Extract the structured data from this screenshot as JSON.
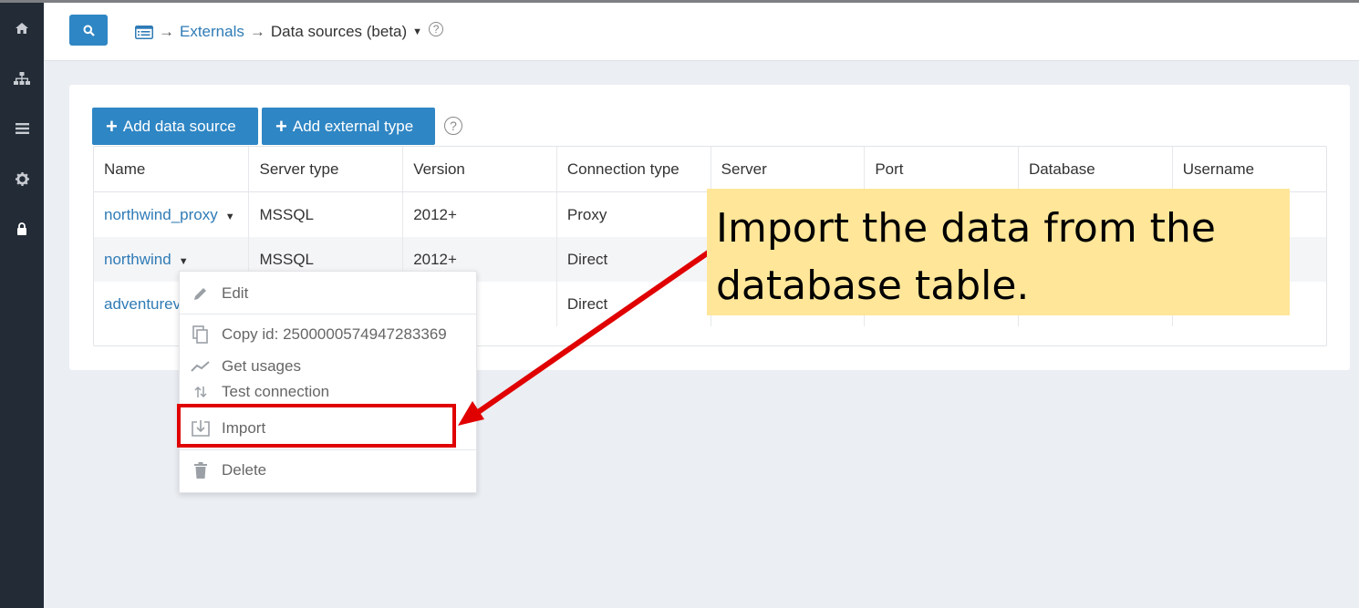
{
  "breadcrumb": {
    "items": [
      "Externals",
      "Data sources (beta)"
    ],
    "separator": "→"
  },
  "toolbar": {
    "add_data_source": "Add data source",
    "add_external_type": "Add external type"
  },
  "table": {
    "columns": [
      "Name",
      "Server type",
      "Version",
      "Connection type",
      "Server",
      "Port",
      "Database",
      "Username"
    ],
    "rows": [
      {
        "name": "northwind_proxy",
        "server_type": "MSSQL",
        "version": "2012+",
        "connection_type": "Proxy"
      },
      {
        "name": "northwind",
        "server_type": "MSSQL",
        "version": "2012+",
        "connection_type": "Direct"
      },
      {
        "name": "adventurev",
        "server_type": "",
        "version": "",
        "connection_type": "Direct"
      }
    ]
  },
  "context_menu": {
    "items": [
      "Edit",
      "Copy id: 2500000574947283369",
      "Get usages",
      "Test connection",
      "Import",
      "Delete"
    ]
  },
  "callout": {
    "line1": "Import the data from the",
    "line2": "database table."
  },
  "colors": {
    "accent": "#2f86c4",
    "link": "#2f7bb6",
    "sidebar": "#222b36",
    "callout_bg": "#ffe699",
    "highlight": "#e00000"
  }
}
